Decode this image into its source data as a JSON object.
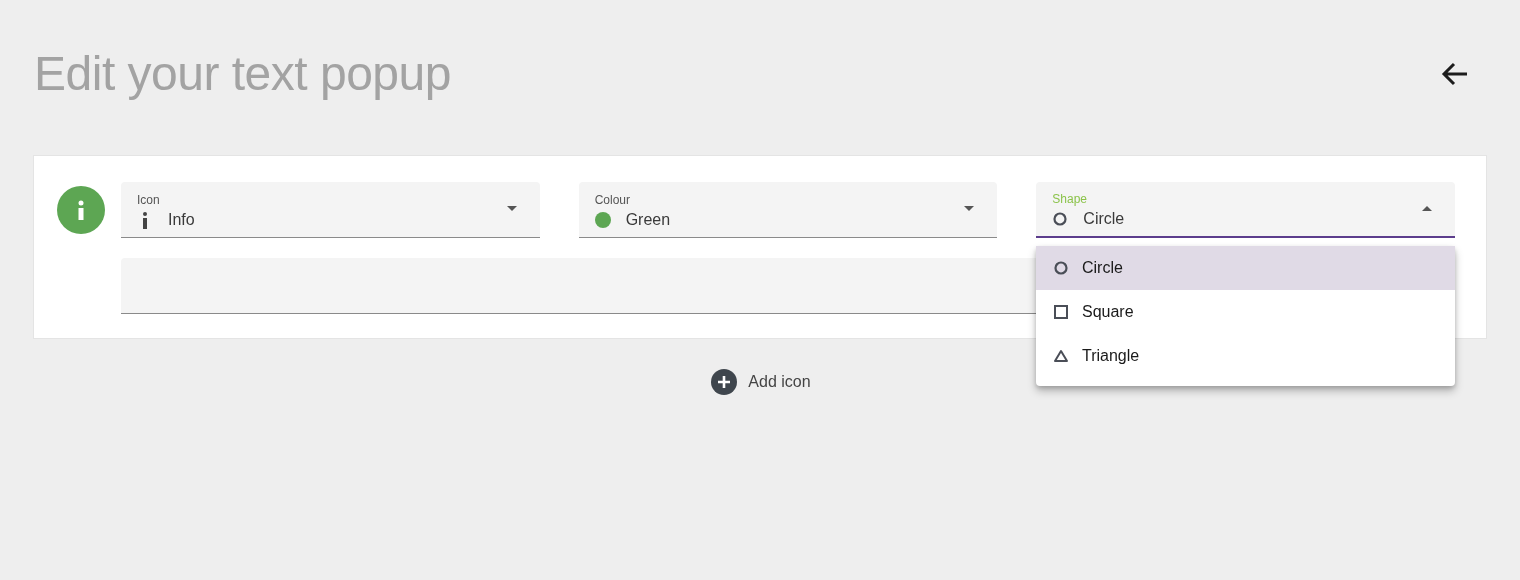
{
  "page": {
    "title": "Edit your text popup"
  },
  "icon_row": {
    "badge": {
      "kind": "info",
      "color": "#5da653"
    },
    "fields": [
      {
        "label": "Icon",
        "value": "Info",
        "kind": "info",
        "focused": false,
        "expanded": false
      },
      {
        "label": "Colour",
        "value": "Green",
        "kind": "swatch",
        "color": "#5da653",
        "focused": false,
        "expanded": false
      },
      {
        "label": "Shape",
        "value": "Circle",
        "kind": "circle",
        "focused": true,
        "expanded": true
      }
    ]
  },
  "menu": {
    "options": [
      {
        "label": "Circle",
        "kind": "circle",
        "selected": true
      },
      {
        "label": "Square",
        "kind": "square",
        "selected": false
      },
      {
        "label": "Triangle",
        "kind": "triangle",
        "selected": false
      }
    ]
  },
  "add_button": {
    "label": "Add icon"
  }
}
